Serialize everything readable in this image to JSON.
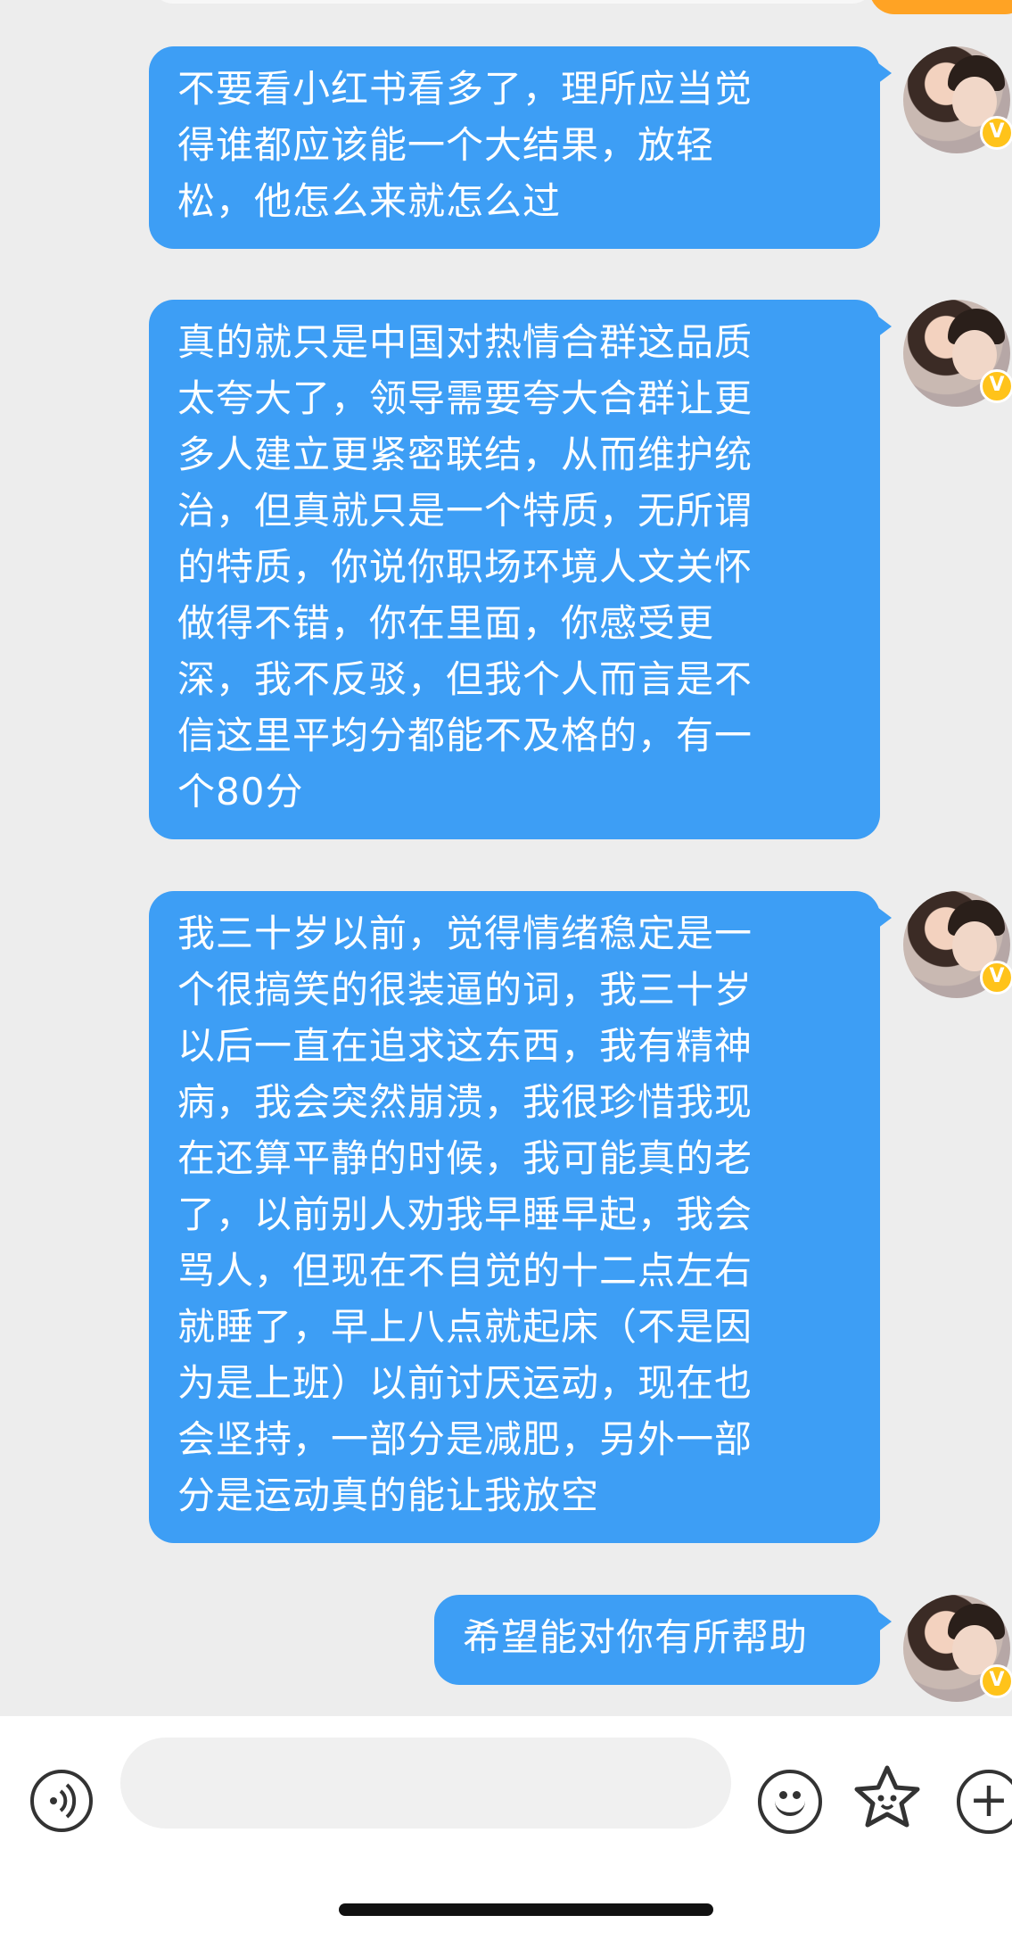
{
  "messages": [
    {
      "text": "不要看小红书看多了，理所应当觉\n得谁都应该能一个大结果，放轻\n松，他怎么来就怎么过"
    },
    {
      "text": "真的就只是中国对热情合群这品质\n太夸大了，领导需要夸大合群让更\n多人建立更紧密联结，从而维护统\n治，但真就只是一个特质，无所谓\n的特质，你说你职场环境人文关怀\n做得不错，你在里面，你感受更\n深，我不反驳，但我个人而言是不\n信这里平均分都能不及格的，有一\n个80分"
    },
    {
      "text": "我三十岁以前，觉得情绪稳定是一\n个很搞笑的很装逼的词，我三十岁\n以后一直在追求这东西，我有精神\n病，我会突然崩溃，我很珍惜我现\n在还算平静的时候，我可能真的老\n了，以前别人劝我早睡早起，我会\n骂人，但现在不自觉的十二点左右\n就睡了，早上八点就起床（不是因\n为是上班）以前讨厌运动，现在也\n会坚持，一部分是减肥，另外一部\n分是运动真的能让我放空"
    },
    {
      "text": "希望能对你有所帮助"
    }
  ],
  "avatar_badge": "V",
  "input": {
    "placeholder": "",
    "value": ""
  },
  "icons": {
    "voice": "voice-icon",
    "emoji": "emoji-icon",
    "sticker": "sticker-icon",
    "plus": "plus-icon"
  },
  "colors": {
    "bubble": "#3d9ef5",
    "background": "#ededed",
    "badge": "#ffc31a"
  }
}
